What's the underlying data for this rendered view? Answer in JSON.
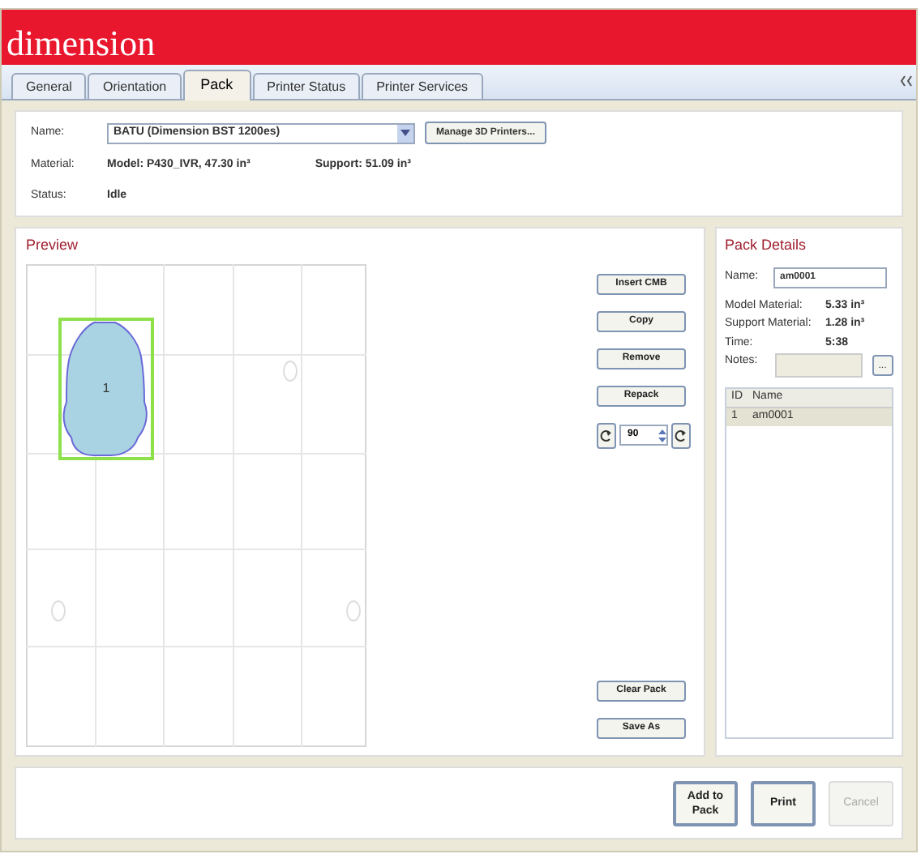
{
  "logo": "dimension",
  "tabs": [
    {
      "label": "General",
      "selected": false
    },
    {
      "label": "Orientation",
      "selected": false
    },
    {
      "label": "Pack",
      "selected": true
    },
    {
      "label": "Printer Status",
      "selected": false
    },
    {
      "label": "Printer Services",
      "selected": false
    }
  ],
  "printer": {
    "name_label": "Name:",
    "name_value": "BATU (Dimension BST 1200es)",
    "manage_button": "Manage 3D Printers...",
    "material_label": "Material:",
    "model_material": "Model: P430_IVR, 47.30 in³",
    "support_material": "Support: 51.09 in³",
    "status_label": "Status:",
    "status": "Idle"
  },
  "preview": {
    "title": "Preview",
    "parts": [
      {
        "label": "1",
        "selected": true
      }
    ]
  },
  "tools": {
    "buttons": [
      "Insert CMB",
      "Copy",
      "Remove",
      "Repack"
    ],
    "rotation": "90",
    "bottom_buttons": [
      "Clear Pack",
      "Save As"
    ]
  },
  "pack_details": {
    "title": "Pack Details",
    "name_label": "Name:",
    "name_value": "am0001",
    "stats": [
      {
        "label": "Model Material:",
        "value": "5.33 in³"
      },
      {
        "label": "Support Material:",
        "value": "1.28 in³"
      },
      {
        "label": "Time:",
        "value": "5:38"
      }
    ],
    "notes_label": "Notes:",
    "notes_button": "...",
    "columns": [
      "ID",
      "Name"
    ],
    "rows": [
      {
        "id": "1",
        "name": "am0001",
        "selected": true
      }
    ]
  },
  "actions": [
    {
      "label": "Add to Pack",
      "disabled": false
    },
    {
      "label": "Print",
      "disabled": false
    },
    {
      "label": "Cancel",
      "disabled": true
    }
  ]
}
